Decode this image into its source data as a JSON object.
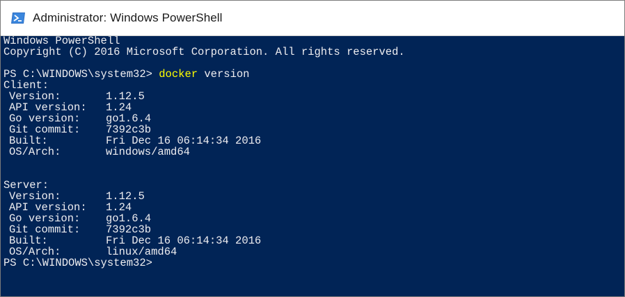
{
  "window": {
    "title": "Administrator: Windows PowerShell"
  },
  "colors": {
    "console_background": "#012456",
    "console_text": "#eeedf0",
    "command_highlight": "#ffff00"
  },
  "console": {
    "banner_line1": "Windows PowerShell",
    "banner_line2": "Copyright (C) 2016 Microsoft Corporation. All rights reserved.",
    "prompt1": "PS C:\\WINDOWS\\system32> ",
    "command_keyword": "docker",
    "command_args": " version",
    "client_header": "Client:",
    "client": [
      {
        "label": "Version:",
        "value": "1.12.5"
      },
      {
        "label": "API version:",
        "value": "1.24"
      },
      {
        "label": "Go version:",
        "value": "go1.6.4"
      },
      {
        "label": "Git commit:",
        "value": "7392c3b"
      },
      {
        "label": "Built:",
        "value": "Fri Dec 16 06:14:34 2016"
      },
      {
        "label": "OS/Arch:",
        "value": "windows/amd64"
      }
    ],
    "server_header": "Server:",
    "server": [
      {
        "label": "Version:",
        "value": "1.12.5"
      },
      {
        "label": "API version:",
        "value": "1.24"
      },
      {
        "label": "Go version:",
        "value": "go1.6.4"
      },
      {
        "label": "Git commit:",
        "value": "7392c3b"
      },
      {
        "label": "Built:",
        "value": "Fri Dec 16 06:14:34 2016"
      },
      {
        "label": "OS/Arch:",
        "value": "linux/amd64"
      }
    ],
    "prompt2": "PS C:\\WINDOWS\\system32>"
  }
}
